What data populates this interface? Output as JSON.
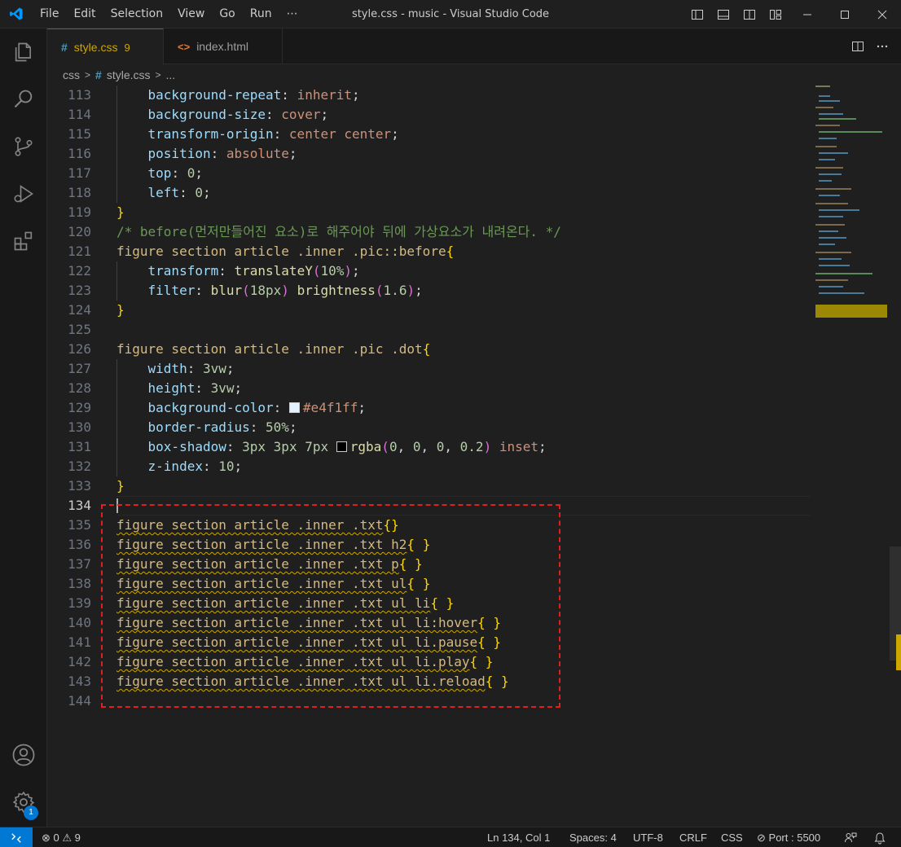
{
  "window": {
    "title": "style.css - music - Visual Studio Code",
    "menu": [
      "File",
      "Edit",
      "Selection",
      "View",
      "Go",
      "Run",
      "⋯"
    ]
  },
  "activity_bar": {
    "icons": [
      "explorer-icon",
      "search-icon",
      "source-control-icon",
      "run-debug-icon",
      "extensions-icon",
      "account-icon",
      "settings-gear-icon"
    ],
    "settings_badge": "1"
  },
  "tabs": [
    {
      "label": "style.css",
      "icon": "#",
      "problems": "9",
      "active": true
    },
    {
      "label": "index.html",
      "icon": "<>",
      "active": false
    }
  ],
  "breadcrumb": {
    "folder": "css",
    "file": "style.css",
    "symbol": "..."
  },
  "editor": {
    "lines": [
      {
        "n": "113"
      },
      {
        "n": "114"
      },
      {
        "n": "115"
      },
      {
        "n": "116"
      },
      {
        "n": "117"
      },
      {
        "n": "118"
      },
      {
        "n": "119"
      },
      {
        "n": "120"
      },
      {
        "n": "121"
      },
      {
        "n": "122"
      },
      {
        "n": "123"
      },
      {
        "n": "124"
      },
      {
        "n": "125"
      },
      {
        "n": "126"
      },
      {
        "n": "127"
      },
      {
        "n": "128"
      },
      {
        "n": "129"
      },
      {
        "n": "130"
      },
      {
        "n": "131"
      },
      {
        "n": "132"
      },
      {
        "n": "133"
      },
      {
        "n": "134"
      },
      {
        "n": "135"
      },
      {
        "n": "136"
      },
      {
        "n": "137"
      },
      {
        "n": "138"
      },
      {
        "n": "139"
      },
      {
        "n": "140"
      },
      {
        "n": "141"
      },
      {
        "n": "142"
      },
      {
        "n": "143"
      },
      {
        "n": "144"
      }
    ],
    "code": {
      "l113_prop": "background-repeat",
      "l113_val": "inherit",
      "l114_prop": "background-size",
      "l114_val": "cover",
      "l115_prop": "transform-origin",
      "l115_val": "center center",
      "l116_prop": "position",
      "l116_val": "absolute",
      "l117_prop": "top",
      "l117_val": "0",
      "l118_prop": "left",
      "l118_val": "0",
      "l120_comment": "/* before(먼저만들어진 요소)로 해주어야 뒤에 가상요소가 내려온다. */",
      "l121_sel": "figure section article .inner .pic::before",
      "l122_prop": "transform",
      "l122_fn": "translateY",
      "l122_arg": "10%",
      "l123_prop": "filter",
      "l123_fn1": "blur",
      "l123_arg1": "18px",
      "l123_fn2": "brightness",
      "l123_arg2": "1.6",
      "l126_sel": "figure section article .inner .pic .dot",
      "l127_prop": "width",
      "l127_val": "3vw",
      "l128_prop": "height",
      "l128_val": "3vw",
      "l129_prop": "background-color",
      "l129_val": "#e4f1ff",
      "l129_swatch": "#e4f1ff",
      "l130_prop": "border-radius",
      "l130_val": "50%",
      "l131_prop": "box-shadow",
      "l131_n1": "3px",
      "l131_n2": "3px",
      "l131_n3": "7px",
      "l131_fn": "rgba",
      "l131_a1": "0",
      "l131_a2": "0",
      "l131_a3": "0",
      "l131_a4": "0.2",
      "l131_kw": "inset",
      "l131_swatch": "#000000",
      "l132_prop": "z-index",
      "l132_val": "10",
      "l135": "figure section article .inner .txt",
      "l135_b": "{}",
      "l136": "figure section article .inner .txt h2",
      "l137": "figure section article .inner .txt p",
      "l138": "figure section article .inner .txt ul",
      "l139": "figure section article .inner .txt ul li",
      "l140": "figure section article .inner .txt ul li:hover",
      "l141": "figure section article .inner .txt ul li.pause",
      "l142": "figure section article .inner .txt ul li.play",
      "l143": "figure section article .inner .txt ul li.reload",
      "empty_block": "{ }"
    }
  },
  "status_bar": {
    "errors": "0",
    "warnings": "9",
    "position": "Ln 134, Col 1",
    "spaces": "Spaces: 4",
    "encoding": "UTF-8",
    "eol": "CRLF",
    "language": "CSS",
    "port": "Port : 5500"
  },
  "colors": {
    "accent": "#0078d4",
    "warning": "#cca700",
    "annotation_box": "#e02020"
  }
}
